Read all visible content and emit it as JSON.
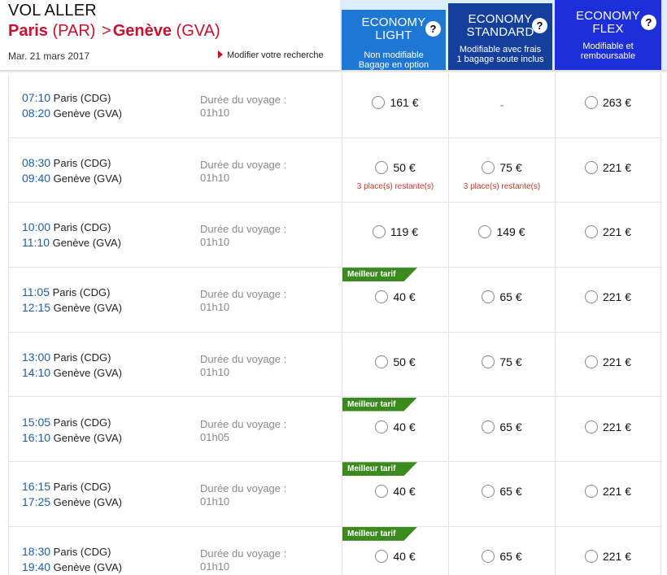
{
  "header": {
    "title": "VOL ALLER",
    "origin_city": "Paris",
    "origin_code": "(PAR)",
    "separator": ">",
    "dest_city": "Genève",
    "dest_code": "(GVA)",
    "date": "Mar. 21 mars 2017",
    "modify_label": "Modifier votre recherche"
  },
  "fares": [
    {
      "name1": "ECONOMY",
      "name2": "LIGHT",
      "desc1": "Non modifiable",
      "desc2": "Bagage en option",
      "help": "?"
    },
    {
      "name1": "ECONOMY",
      "name2": "STANDARD",
      "desc1": "Modifiable avec frais",
      "desc2": "1 bagage soute inclus",
      "help": "?"
    },
    {
      "name1": "ECONOMY",
      "name2": "FLEX",
      "desc1": "Modifiable et",
      "desc2": "remboursable",
      "help": "?"
    }
  ],
  "labels": {
    "duration": "Durée du voyage :",
    "best_fare": "Meilleur tarif",
    "remaining": "3 place(s) restante(s)",
    "unavailable": "-"
  },
  "colors": {
    "light": "#1f77d4",
    "standard": "#143f9c",
    "flex": "#1c2fd8",
    "route": "#c8102e",
    "badge": "#3a8a1f"
  },
  "flights": [
    {
      "dep_time": "07:10",
      "dep_place": "Paris (CDG)",
      "arr_time": "08:20",
      "arr_place": "Genève (GVA)",
      "duration": "01h10",
      "best": false,
      "light": "161 €",
      "standard": "-",
      "flex": "263 €",
      "light_remain": "",
      "standard_remain": ""
    },
    {
      "dep_time": "08:30",
      "dep_place": "Paris (CDG)",
      "arr_time": "09:40",
      "arr_place": "Genève (GVA)",
      "duration": "01h10",
      "best": false,
      "light": "50 €",
      "standard": "75 €",
      "flex": "221 €",
      "light_remain": "3 place(s) restante(s)",
      "standard_remain": "3 place(s) restante(s)"
    },
    {
      "dep_time": "10:00",
      "dep_place": "Paris (CDG)",
      "arr_time": "11:10",
      "arr_place": "Genève (GVA)",
      "duration": "01h10",
      "best": false,
      "light": "119 €",
      "standard": "149 €",
      "flex": "221 €",
      "light_remain": "",
      "standard_remain": ""
    },
    {
      "dep_time": "11:05",
      "dep_place": "Paris (CDG)",
      "arr_time": "12:15",
      "arr_place": "Genève (GVA)",
      "duration": "01h10",
      "best": true,
      "light": "40 €",
      "standard": "65 €",
      "flex": "221 €",
      "light_remain": "",
      "standard_remain": ""
    },
    {
      "dep_time": "13:00",
      "dep_place": "Paris (CDG)",
      "arr_time": "14:10",
      "arr_place": "Genève (GVA)",
      "duration": "01h10",
      "best": false,
      "light": "50 €",
      "standard": "75 €",
      "flex": "221 €",
      "light_remain": "",
      "standard_remain": ""
    },
    {
      "dep_time": "15:05",
      "dep_place": "Paris (CDG)",
      "arr_time": "16:10",
      "arr_place": "Genève (GVA)",
      "duration": "01h05",
      "best": true,
      "light": "40 €",
      "standard": "65 €",
      "flex": "221 €",
      "light_remain": "",
      "standard_remain": ""
    },
    {
      "dep_time": "16:15",
      "dep_place": "Paris (CDG)",
      "arr_time": "17:25",
      "arr_place": "Genève (GVA)",
      "duration": "01h10",
      "best": true,
      "light": "40 €",
      "standard": "65 €",
      "flex": "221 €",
      "light_remain": "",
      "standard_remain": ""
    },
    {
      "dep_time": "18:30",
      "dep_place": "Paris (CDG)",
      "arr_time": "19:40",
      "arr_place": "Genève (GVA)",
      "duration": "01h10",
      "best": true,
      "light": "40 €",
      "standard": "65 €",
      "flex": "221 €",
      "light_remain": "",
      "standard_remain": ""
    }
  ]
}
